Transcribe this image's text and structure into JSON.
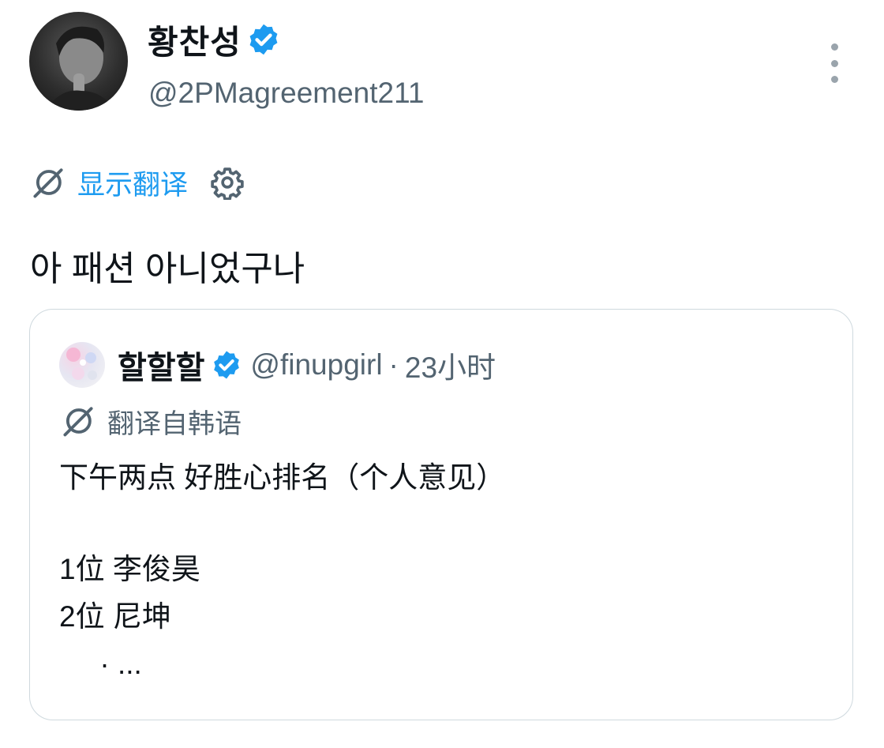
{
  "tweet": {
    "author_name": "황찬성",
    "author_handle": "@2PMagreement211",
    "translate_label": "显示翻译",
    "text": "아 패션 아니었구나"
  },
  "quote": {
    "author_name": "할할할",
    "author_handle": "@finupgirl",
    "separator": "·",
    "time": "23小时",
    "translated_from": "翻译自韩语",
    "lines": [
      "下午两点 好胜心排名（个人意见）",
      "1位 李俊昊",
      "2位 尼坤",
      "     · ..."
    ]
  },
  "icons": {
    "verified": "verified-badge-icon",
    "translate": "translate-globe-icon",
    "settings": "gear-icon",
    "more": "more-vertical-icon"
  },
  "colors": {
    "link": "#1d9bf0",
    "secondary_text": "#536471",
    "border": "#cfd9de"
  }
}
